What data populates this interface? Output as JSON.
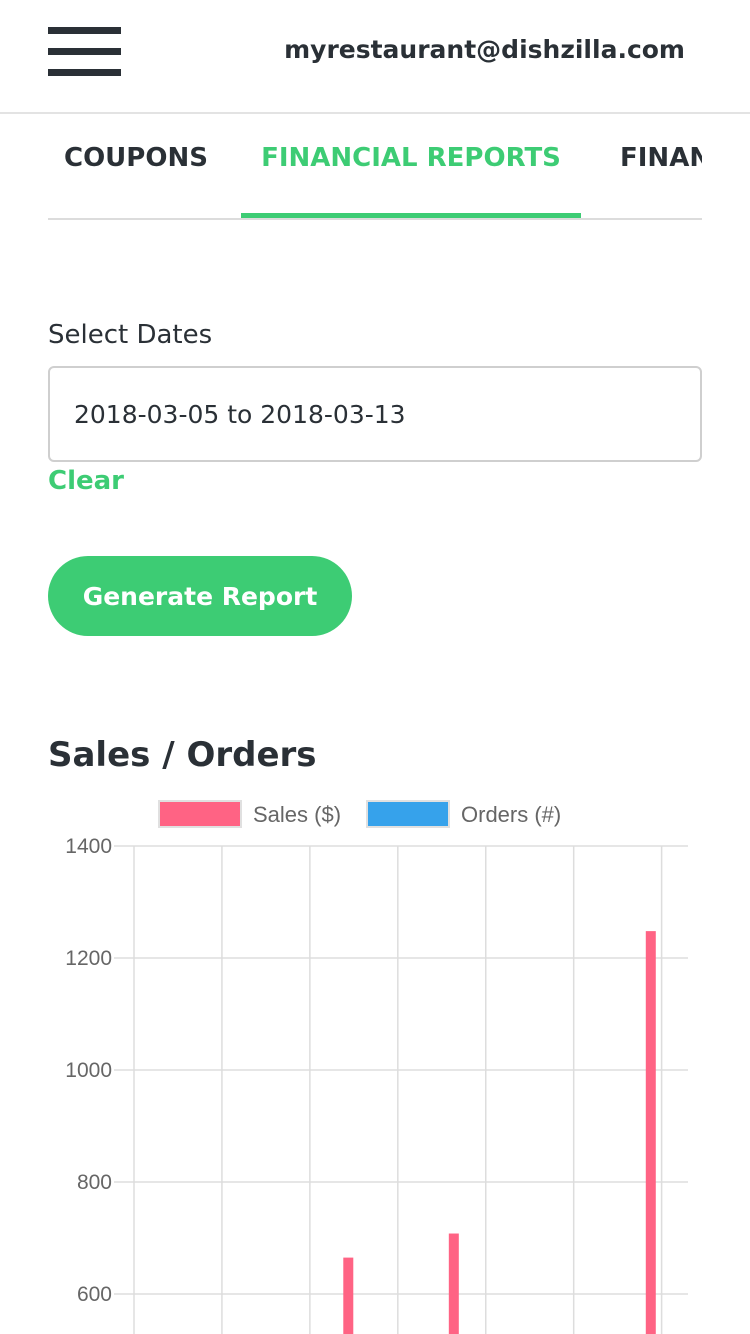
{
  "header": {
    "email": "myrestaurant@dishzilla.com",
    "menu_icon": "hamburger-menu-icon"
  },
  "tabs": [
    {
      "label": "COUPONS",
      "active": false
    },
    {
      "label": "FINANCIAL REPORTS",
      "active": true
    },
    {
      "label": "FINAN",
      "active": false
    }
  ],
  "form": {
    "dates_label": "Select Dates",
    "dates_value": "2018-03-05 to 2018-03-13",
    "clear_label": "Clear",
    "generate_label": "Generate Report"
  },
  "section": {
    "title": "Sales / Orders"
  },
  "colors": {
    "accent": "#3dcc74",
    "sales": "#ff6384",
    "orders": "#36a2eb",
    "text": "#2a3036"
  },
  "chart_data": {
    "type": "bar",
    "title": "",
    "xlabel": "",
    "ylabel": "",
    "series": [
      {
        "name": "Sales ($)",
        "values": [
          null,
          null,
          665,
          708,
          null,
          1248
        ]
      },
      {
        "name": "Orders (#)",
        "values": [
          null,
          null,
          null,
          null,
          null,
          null
        ]
      }
    ],
    "y_ticks": [
      1400,
      1200,
      1000,
      800,
      600
    ],
    "ylim_visible": [
      560,
      1400
    ],
    "grid": true,
    "legend": "top"
  }
}
